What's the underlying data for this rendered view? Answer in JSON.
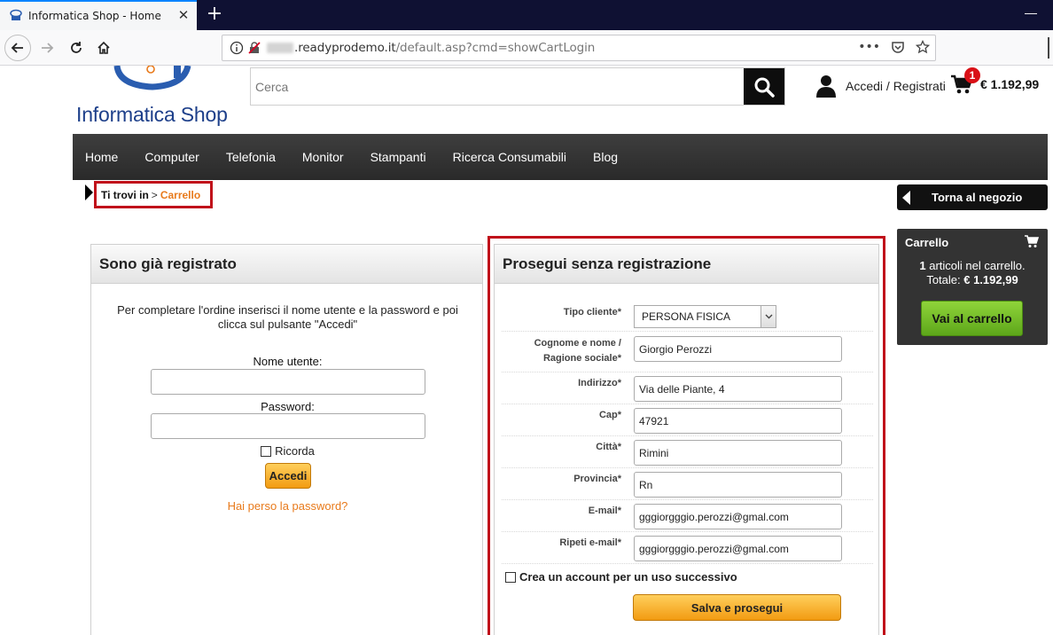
{
  "browser": {
    "tab_title": "Informatica Shop - Home",
    "tab_close": "✕",
    "new_tab": "+",
    "url_host": ".readyprodemo.it",
    "url_path": "/default.asp?cmd=showCartLogin",
    "url_more": "•••"
  },
  "header": {
    "logo_text": "Informatica Shop",
    "search_placeholder": "Cerca",
    "user_link": "Accedi / Registrati",
    "cart_badge": "1",
    "cart_total": "€ 1.192,99"
  },
  "menu": {
    "items": [
      {
        "label": "Home"
      },
      {
        "label": "Computer"
      },
      {
        "label": "Telefonia"
      },
      {
        "label": "Monitor"
      },
      {
        "label": "Stampanti"
      },
      {
        "label": "Ricerca Consumabili"
      },
      {
        "label": "Blog"
      }
    ]
  },
  "breadcrumb": {
    "label": "Ti trovi in",
    "separator": ">",
    "current": "Carrello"
  },
  "back_shop": {
    "label": "Torna al negozio"
  },
  "cart_widget": {
    "title": "Carrello",
    "count": "1",
    "count_suffix": " articoli nel carrello.",
    "total_label": "Totale: ",
    "total": "€ 1.192,99",
    "button": "Vai al carrello"
  },
  "login": {
    "title": "Sono già registrato",
    "description": "Per completare l'ordine inserisci il nome utente e la password e poi clicca sul pulsante \"Accedi\"",
    "username_label": "Nome utente:",
    "password_label": "Password:",
    "remember_label": "Ricorda",
    "submit": "Accedi",
    "lost_password": "Hai perso la password?"
  },
  "guest": {
    "title": "Prosegui senza registrazione",
    "customer_type_label": "Tipo cliente*",
    "customer_type_value": "PERSONA FISICA",
    "name_label_1": "Cognome e nome /",
    "name_label_2": "Ragione sociale*",
    "name_value": "Giorgio Perozzi",
    "address_label": "Indirizzo*",
    "address_value": "Via delle Piante, 4",
    "cap_label": "Cap*",
    "cap_value": "47921",
    "city_label": "Città*",
    "city_value": "Rimini",
    "province_label": "Provincia*",
    "province_value": "Rn",
    "email_label": "E-mail*",
    "email_value": "gggiorgggio.perozzi@gmal.com",
    "email_repeat_label": "Ripeti e-mail*",
    "email_repeat_value": "gggiorgggio.perozzi@gmal.com",
    "create_account_label": "Crea un account per un uso successivo",
    "submit": "Salva e prosegui"
  },
  "colors": {
    "highlight": "#c0101a",
    "link_orange": "#e87a1b",
    "menu_bg": "#333333",
    "button_orange": "#f5a623",
    "button_green": "#72bf27",
    "logo_blue": "#1d3f8a"
  }
}
